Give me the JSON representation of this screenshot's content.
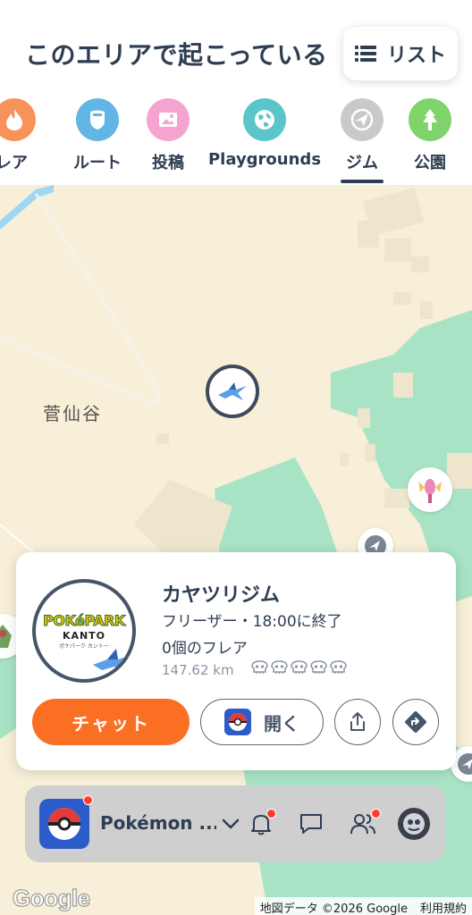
{
  "header": {
    "title": "このエリアで起こっている",
    "list_button": {
      "label": "リスト",
      "icon": "list-icon"
    }
  },
  "tabs": [
    {
      "label": "フレア",
      "icon": "flame-icon",
      "color": "#f7935a"
    },
    {
      "label": "ルート",
      "icon": "shield-icon",
      "color": "#62b6e6"
    },
    {
      "label": "投稿",
      "icon": "image-icon",
      "color": "#f5a3cf"
    },
    {
      "label": "Playgrounds",
      "icon": "globe-icon",
      "color": "#5ac6c9"
    },
    {
      "label": "ジム",
      "icon": "gym-icon",
      "color": "#c9c9c9",
      "active": true
    },
    {
      "label": "公園",
      "icon": "tree-icon",
      "color": "#7fd36b"
    }
  ],
  "map": {
    "place_label": "菅仙谷"
  },
  "card": {
    "gym_name": "カヤツリジム",
    "boss_line": "フリーザー・18:00に終了",
    "flare_count": "0個のフレア",
    "distance": "147.62 km",
    "difficulty_skulls": 5,
    "logo": {
      "line1": "POKéPARK",
      "line2": "KANTO",
      "line3": "ポケパーク カントー"
    },
    "chat_button": "チャット",
    "open_button": "開く"
  },
  "bottom_bar": {
    "app_name": "Pokémon ...",
    "icons": [
      "bell-icon",
      "chat-bubble-icon",
      "people-icon",
      "avatar"
    ]
  },
  "map_footer": {
    "logo": "Google",
    "credit": "地図データ ©2026 Google",
    "terms": "利用規約"
  },
  "colors": {
    "accent": "#fb6f24",
    "text": "#2f3d52",
    "map_land": "#f7efd7",
    "map_green": "#a9e3c6"
  }
}
